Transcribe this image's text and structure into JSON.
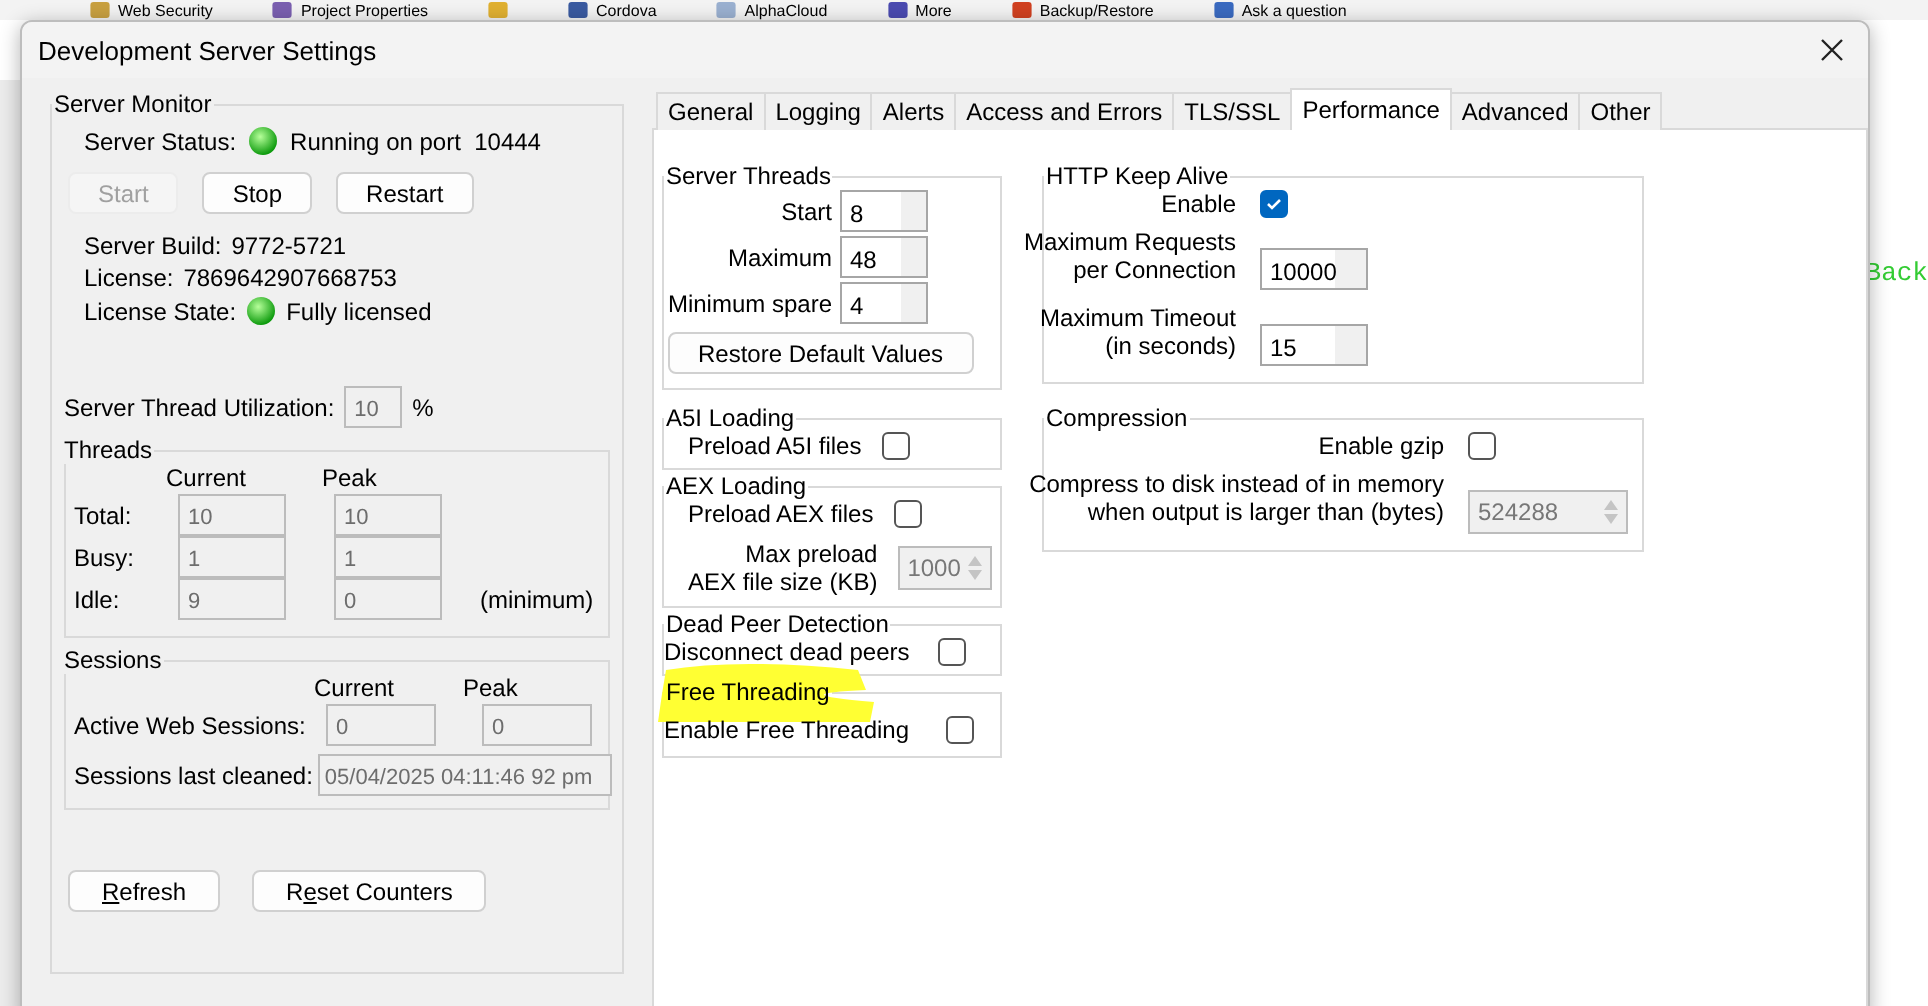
{
  "background": {
    "toolbar": [
      {
        "kind": "labelled",
        "label": "Web Security"
      },
      {
        "kind": "labelled",
        "label": "Project Properties"
      },
      {
        "kind": "icon"
      },
      {
        "kind": "labelled",
        "label": "Cordova"
      },
      {
        "kind": "labelled",
        "label": "AlphaCloud"
      },
      {
        "kind": "labelled",
        "label": "More"
      },
      {
        "kind": "labelled",
        "label": "Backup/Restore"
      },
      {
        "kind": "labelled",
        "label": "Ask a question"
      }
    ],
    "side_text": "Back"
  },
  "window": {
    "title": "Development Server Settings"
  },
  "server_monitor": {
    "title": "Server Monitor",
    "status_label": "Server Status:",
    "status": "Running on port  10444",
    "status_ok": true,
    "buttons": [
      {
        "label": "Start",
        "disabled": true
      },
      {
        "label": "Stop",
        "disabled": false
      },
      {
        "label": "Restart",
        "disabled": false
      }
    ],
    "build_label": "Server Build:",
    "build": "9772-5721",
    "license_label": "License:",
    "license": "7869642907668753",
    "license_state_label": "License State:",
    "license_state": "Fully licensed",
    "license_ok": true,
    "utilization_label": "Server Thread Utilization:",
    "utilization": "10",
    "utilization_unit": "%"
  },
  "threads": {
    "title": "Threads",
    "columns": [
      "Current",
      "Peak"
    ],
    "rows": [
      {
        "label": "Total:",
        "current": "10",
        "peak": "10"
      },
      {
        "label": "Busy:",
        "current": "1",
        "peak": "1"
      },
      {
        "label": "Idle:",
        "current": "9",
        "peak": "0",
        "note": "(minimum)"
      }
    ]
  },
  "sessions": {
    "title": "Sessions",
    "columns": [
      "Current",
      "Peak"
    ],
    "active_label": "Active Web Sessions:",
    "active_current": "0",
    "active_peak": "0",
    "cleaned_label": "Sessions last cleaned:",
    "cleaned": "05/04/2025 04:11:46 92 pm"
  },
  "footer_buttons": [
    {
      "label_parts": [
        {
          "text": "R",
          "underlined": true
        },
        {
          "text": "efresh",
          "underlined": false
        }
      ]
    },
    {
      "label_parts": [
        {
          "text": "R",
          "underlined": false
        },
        {
          "text": "e",
          "underlined": true
        },
        {
          "text": "set Counters",
          "underlined": false
        }
      ]
    }
  ],
  "tabs": [
    {
      "label": "General",
      "selected": false
    },
    {
      "label": "Logging",
      "selected": false
    },
    {
      "label": "Alerts",
      "selected": false
    },
    {
      "label": "Access and Errors",
      "selected": false
    },
    {
      "label": "TLS/SSL",
      "selected": false
    },
    {
      "label": "Performance",
      "selected": true
    },
    {
      "label": "Advanced",
      "selected": false
    },
    {
      "label": "Other",
      "selected": false
    }
  ],
  "server_threads": {
    "title": "Server Threads",
    "fields": [
      {
        "label": "Start",
        "value": "8"
      },
      {
        "label": "Maximum",
        "value": "48"
      },
      {
        "label": "Minimum spare",
        "value": "4"
      }
    ],
    "button": "Restore Default Values"
  },
  "a5i_loading": {
    "title": "A5I Loading",
    "label": "Preload A5I files",
    "checked": false
  },
  "aex_loading": {
    "title": "AEX Loading",
    "label": "Preload AEX files",
    "checked": false,
    "size_label_1": "Max preload",
    "size_label_2": "AEX file size (KB)",
    "size": "1000"
  },
  "dead_peer": {
    "title": "Dead Peer Detection",
    "label": "Disconnect dead peers",
    "checked": false
  },
  "free_threading": {
    "title": "Free Threading",
    "label": "Enable Free Threading",
    "checked": false,
    "highlighted": true
  },
  "keep_alive": {
    "title": "HTTP Keep Alive",
    "enable_label": "Enable",
    "enabled": true,
    "requests_label_1": "Maximum Requests",
    "requests_label_2": "per Connection",
    "requests": "10000",
    "timeout_label_1": "Maximum Timeout",
    "timeout_label_2": "(in seconds)",
    "timeout": "15"
  },
  "compression": {
    "title": "Compression",
    "gzip_label": "Enable gzip",
    "gzip": false,
    "disk_label_1": "Compress to disk instead of in memory",
    "disk_label_2": "when output is larger than (bytes)",
    "disk_size": "524288"
  }
}
